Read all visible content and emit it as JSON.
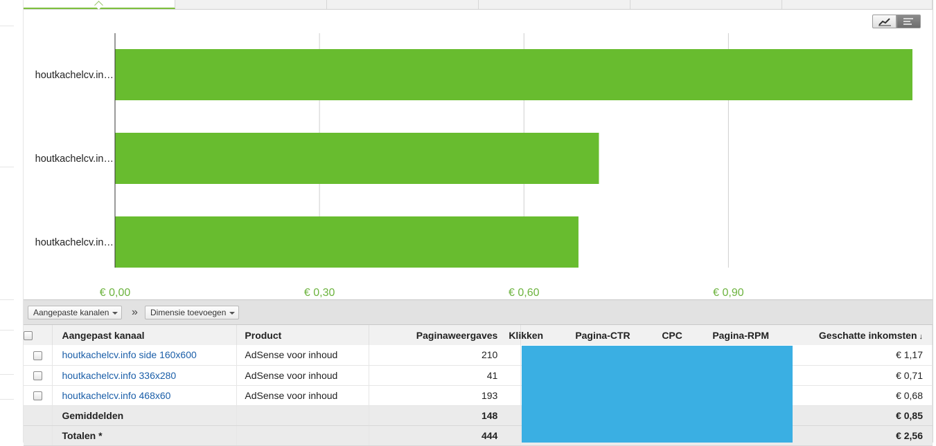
{
  "chart_data": {
    "type": "bar",
    "orientation": "horizontal",
    "categories": [
      "houtkachelcv.in…",
      "houtkachelcv.in…",
      "houtkachelcv.in…"
    ],
    "values": [
      1.17,
      0.71,
      0.68
    ],
    "xlim": [
      0,
      1.17
    ],
    "x_ticks": [
      0,
      0.3,
      0.6,
      0.9
    ],
    "x_tick_labels": [
      "€ 0,00",
      "€ 0,30",
      "€ 0,60",
      "€ 0,90"
    ],
    "grid": true,
    "bar_color": "#68bc2f",
    "tick_color": "#6cb33e"
  },
  "toolbar": {
    "channel_dropdown": "Aangepaste kanalen",
    "separator": "»",
    "dimension_dropdown": "Dimensie toevoegen"
  },
  "table": {
    "headers": {
      "channel": "Aangepast kanaal",
      "product": "Product",
      "pageviews": "Paginaweergaves",
      "clicks": "Klikken",
      "ctr": "Pagina-CTR",
      "cpc": "CPC",
      "rpm": "Pagina-RPM",
      "earnings": "Geschatte inkomsten",
      "sort_indicator": "↓"
    },
    "rows": [
      {
        "channel": "houtkachelcv.info side 160x600",
        "product": "AdSense voor inhoud",
        "pageviews": "210",
        "earnings": "€ 1,17"
      },
      {
        "channel": "houtkachelcv.info 336x280",
        "product": "AdSense voor inhoud",
        "pageviews": "41",
        "earnings": "€ 0,71"
      },
      {
        "channel": "houtkachelcv.info 468x60",
        "product": "AdSense voor inhoud",
        "pageviews": "193",
        "earnings": "€ 0,68"
      }
    ],
    "averages": {
      "label": "Gemiddelden",
      "pageviews": "148",
      "earnings": "€ 0,85"
    },
    "totals": {
      "label": "Totalen *",
      "pageviews": "444",
      "earnings": "€ 2,56"
    }
  },
  "colors": {
    "accent": "#7bbf3a",
    "link": "#1a5ea8",
    "redaction": "#3aafe3"
  }
}
